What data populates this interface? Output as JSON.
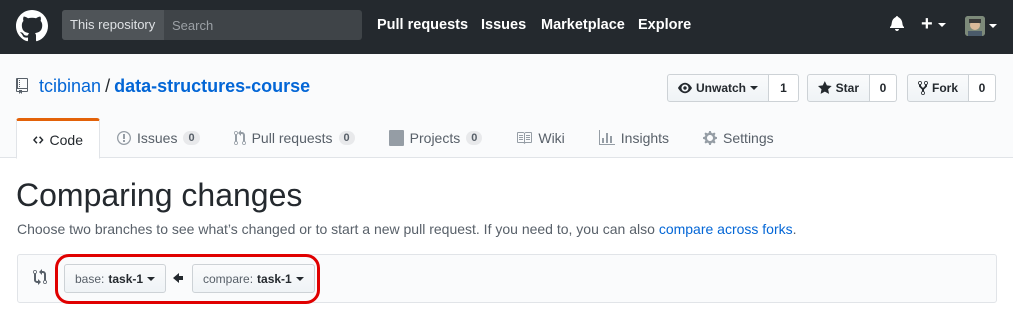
{
  "header": {
    "scope_label": "This repository",
    "search_placeholder": "Search",
    "nav": [
      "Pull requests",
      "Issues",
      "Marketplace",
      "Explore"
    ],
    "plus_label": "+"
  },
  "repo": {
    "owner": "tcibinan",
    "separator": "/",
    "name": "data-structures-course"
  },
  "actions": {
    "watch_label": "Unwatch",
    "watch_count": "1",
    "star_label": "Star",
    "star_count": "0",
    "fork_label": "Fork",
    "fork_count": "0"
  },
  "tabs": [
    {
      "label": "Code",
      "icon": "code-icon"
    },
    {
      "label": "Issues",
      "count": "0",
      "icon": "issue-icon"
    },
    {
      "label": "Pull requests",
      "count": "0",
      "icon": "pull-request-icon"
    },
    {
      "label": "Projects",
      "count": "0",
      "icon": "project-icon"
    },
    {
      "label": "Wiki",
      "icon": "book-icon"
    },
    {
      "label": "Insights",
      "icon": "graph-icon"
    },
    {
      "label": "Settings",
      "icon": "gear-icon"
    }
  ],
  "page": {
    "title": "Comparing changes",
    "description": "Choose two branches to see what’s changed or to start a new pull request. If you need to, you can also ",
    "link": "compare across forks",
    "period": "."
  },
  "compare": {
    "base_prefix": "base:",
    "base_branch": "task-1",
    "compare_prefix": "compare:",
    "compare_branch": "task-1"
  },
  "colors": {
    "header_bg": "#24292e",
    "link": "#0366d6",
    "tab_accent": "#e36209",
    "highlight": "#e00000"
  }
}
